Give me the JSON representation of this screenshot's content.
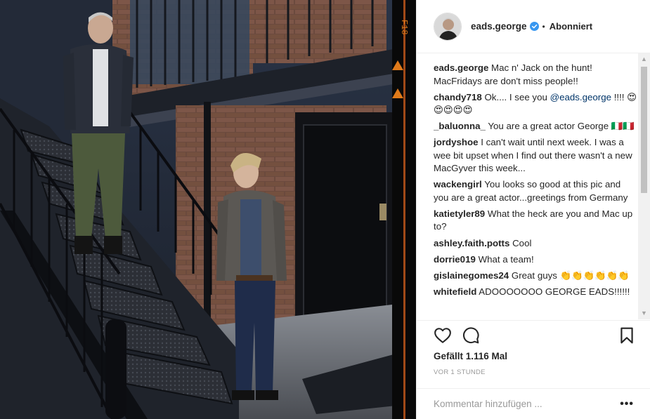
{
  "post": {
    "photo_alt": "",
    "film_edge_text": "F18"
  },
  "header": {
    "username": "eads.george",
    "verified": true,
    "separator": "•",
    "follow_state": "Abonniert"
  },
  "comments": [
    {
      "author": "eads.george",
      "text": "Mac n' Jack on the hunt! MacFridays are don't miss people!!"
    },
    {
      "author": "chandy718",
      "text": "Ok.... I see you ",
      "mention": "@eads.george",
      "text_after": " !!!! 😍😍😍😍😍"
    },
    {
      "author": "_baluonna_",
      "text": "You are a great actor George 🇮🇹🇮🇹"
    },
    {
      "author": "jordyshoe",
      "text": "I can't wait until next week. I was a wee bit upset when I find out there wasn't a new MacGyver this week..."
    },
    {
      "author": "wackengirl",
      "text": "You looks so good at this pic and you are a great actor...greetings from Germany"
    },
    {
      "author": "katietyler89",
      "text": "What the heck are you and Mac up to?"
    },
    {
      "author": "ashley.faith.potts",
      "text": "Cool"
    },
    {
      "author": "dorrie019",
      "text": "What a team!"
    },
    {
      "author": "gislainegomes24",
      "text": "Great guys 👏👏👏👏👏👏"
    },
    {
      "author": "whitefield",
      "text": "ADOOOOOOO GEORGE EADS!!!!!!"
    }
  ],
  "actions": {
    "like_icon": "heart-icon",
    "comment_icon": "speech-bubble-icon",
    "save_icon": "bookmark-icon",
    "likes_text": "Gefällt 1.116 Mal",
    "timestamp": "VOR 1 STUNDE"
  },
  "comment_box": {
    "placeholder": "Kommentar hinzufügen ...",
    "more_label": "•••"
  },
  "colors": {
    "text": "#262626",
    "muted": "#999999",
    "border": "#efefef",
    "verified": "#3897f0",
    "mention": "#003569"
  }
}
